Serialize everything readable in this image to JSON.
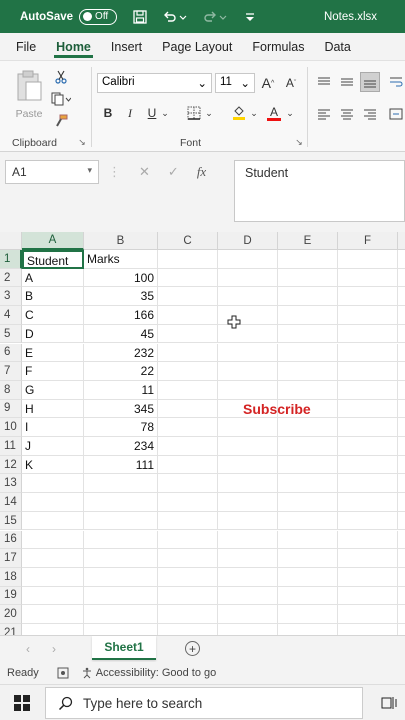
{
  "titlebar": {
    "autosave_label": "AutoSave",
    "autosave_state": "Off",
    "filename": "Notes.xlsx"
  },
  "ribbon_tabs": [
    "File",
    "Home",
    "Insert",
    "Page Layout",
    "Formulas",
    "Data"
  ],
  "ribbon_active_tab": "Home",
  "ribbon": {
    "paste_label": "Paste",
    "clipboard_label": "Clipboard",
    "font_label": "Font",
    "font_name": "Calibri",
    "font_size": "11",
    "bold": "B",
    "italic": "I",
    "underline": "U"
  },
  "formula_bar": {
    "name_box": "A1",
    "fx": "fx",
    "formula": "Student"
  },
  "columns": [
    "A",
    "B",
    "C",
    "D",
    "E",
    "F"
  ],
  "rows": [
    "1",
    "2",
    "3",
    "4",
    "5",
    "6",
    "7",
    "8",
    "9",
    "10",
    "11",
    "12",
    "13",
    "14",
    "15",
    "16",
    "17",
    "18",
    "19",
    "20",
    "21"
  ],
  "cells": {
    "header": [
      "Student",
      "Marks"
    ],
    "data": [
      [
        "A",
        "100"
      ],
      [
        "B",
        "35"
      ],
      [
        "C",
        "166"
      ],
      [
        "D",
        "45"
      ],
      [
        "E",
        "232"
      ],
      [
        "F",
        "22"
      ],
      [
        "G",
        "11"
      ],
      [
        "H",
        "345"
      ],
      [
        "I",
        "78"
      ],
      [
        "J",
        "234"
      ],
      [
        "K",
        "111"
      ]
    ]
  },
  "overlay": {
    "subscribe": "Subscribe"
  },
  "sheets": {
    "active": "Sheet1",
    "add": "+"
  },
  "status": {
    "ready": "Ready",
    "accessibility": "Accessibility: Good to go"
  },
  "taskbar": {
    "search_placeholder": "Type here to search"
  },
  "colors": {
    "excel_green": "#217346",
    "subscribe_red": "#d42323"
  }
}
